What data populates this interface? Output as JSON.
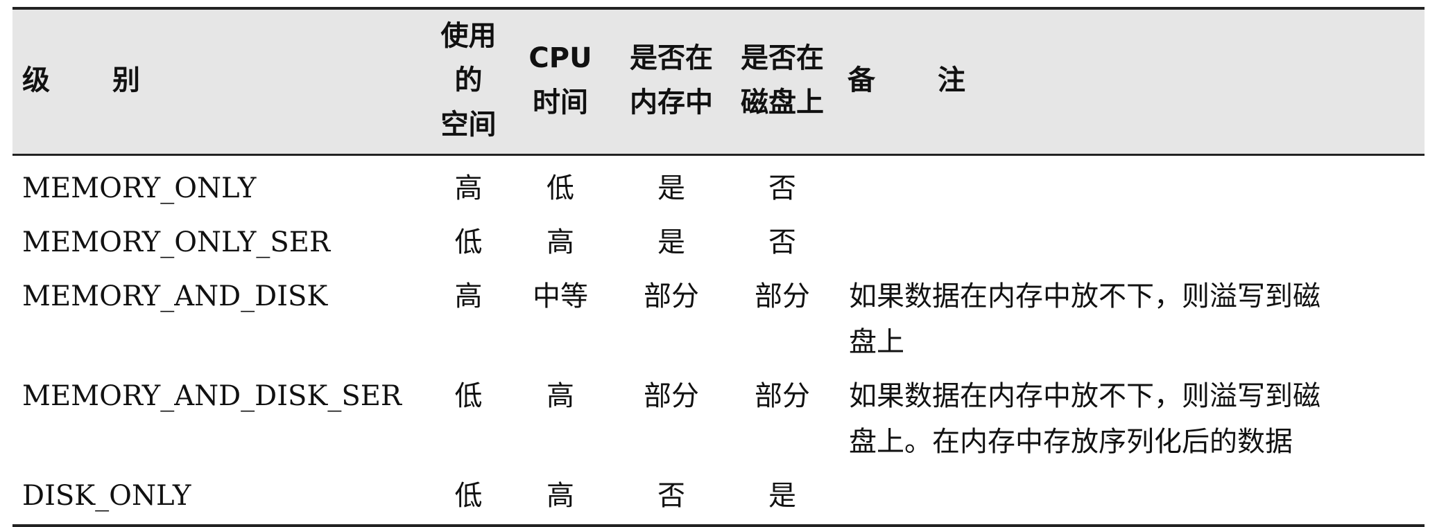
{
  "table": {
    "headers": {
      "level": [
        "级",
        "别"
      ],
      "space": [
        "使用的",
        "空间"
      ],
      "cpu": [
        "CPU",
        "时间"
      ],
      "in_memory": [
        "是否在",
        "内存中"
      ],
      "on_disk": [
        "是否在",
        "磁盘上"
      ],
      "note": [
        "备",
        "注"
      ]
    },
    "rows": [
      {
        "level": "MEMORY_ONLY",
        "space": "高",
        "cpu": "低",
        "in_memory": "是",
        "on_disk": "否",
        "note_lines": []
      },
      {
        "level": "MEMORY_ONLY_SER",
        "space": "低",
        "cpu": "高",
        "in_memory": "是",
        "on_disk": "否",
        "note_lines": []
      },
      {
        "level": "MEMORY_AND_DISK",
        "space": "高",
        "cpu": "中等",
        "in_memory": "部分",
        "on_disk": "部分",
        "note_lines": [
          "如果数据在内存中放不下，则溢写到磁",
          "盘上"
        ]
      },
      {
        "level": "MEMORY_AND_DISK_SER",
        "space": "低",
        "cpu": "高",
        "in_memory": "部分",
        "on_disk": "部分",
        "note_lines": [
          "如果数据在内存中放不下，则溢写到磁",
          "盘上。在内存中存放序列化后的数据"
        ]
      },
      {
        "level": "DISK_ONLY",
        "space": "低",
        "cpu": "高",
        "in_memory": "否",
        "on_disk": "是",
        "note_lines": []
      }
    ]
  }
}
